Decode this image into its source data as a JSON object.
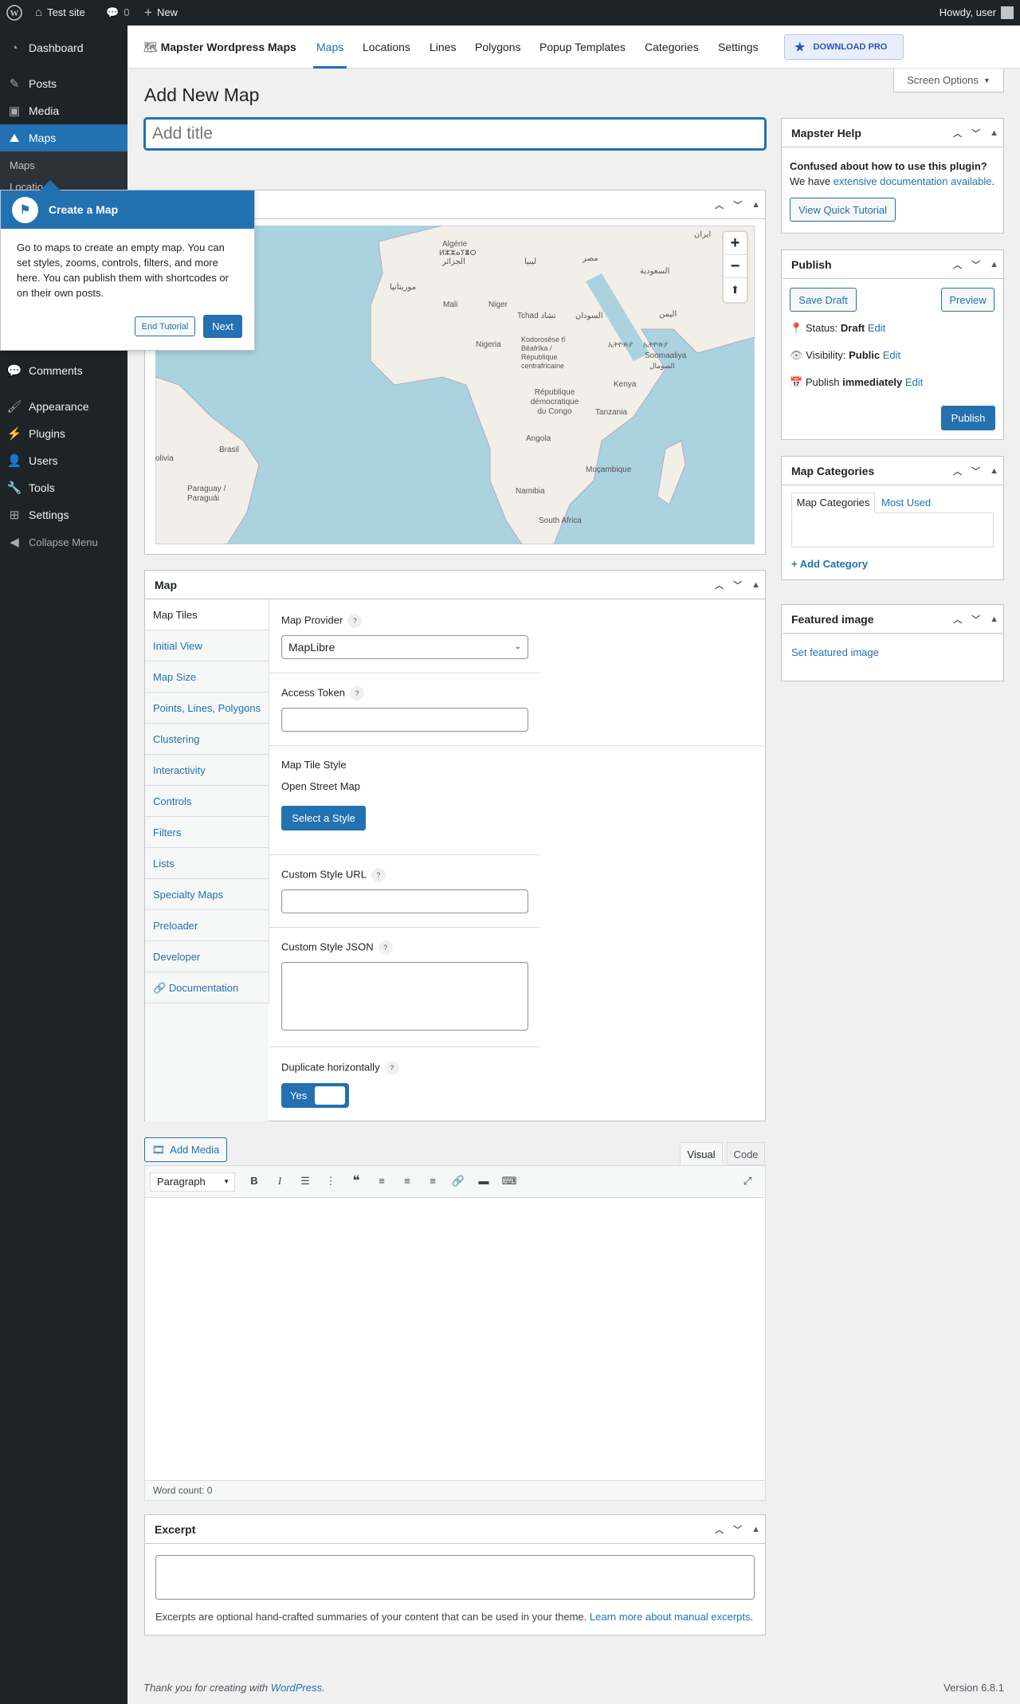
{
  "adminbar": {
    "site": "Test site",
    "comments": "0",
    "new": "New",
    "howdy": "Howdy, user"
  },
  "sidebar": {
    "items": [
      {
        "label": "Dashboard"
      },
      {
        "label": "Posts"
      },
      {
        "label": "Media"
      },
      {
        "label": "Maps"
      },
      {
        "label": "Comments"
      },
      {
        "label": "Appearance"
      },
      {
        "label": "Plugins"
      },
      {
        "label": "Users"
      },
      {
        "label": "Tools"
      },
      {
        "label": "Settings"
      },
      {
        "label": "Collapse Menu"
      }
    ],
    "submenu": [
      "Maps",
      "Locatio"
    ]
  },
  "tour": {
    "title": "Create a Map",
    "body": "Go to maps to create an empty map. You can set styles, zooms, controls, filters, and more here. You can publish them with shortcodes or on their own posts.",
    "end": "End Tutorial",
    "next": "Next"
  },
  "plugin_header": {
    "brand": "Mapster Wordpress Maps",
    "tabs": [
      "Maps",
      "Locations",
      "Lines",
      "Polygons",
      "Popup Templates",
      "Categories",
      "Settings"
    ],
    "download": "DOWNLOAD PRO"
  },
  "screen_options": "Screen Options",
  "page_title": "Add New Map",
  "title_placeholder": "Add title",
  "map_preview": {
    "labels": [
      "Algérie",
      "الجزائر",
      "ⵍⵣⵣⴰⵢⴻⵔ",
      "ليبيا",
      "مصر",
      "ایران",
      "السعودية",
      "موريتانيا",
      "Mali",
      "Niger",
      "Tchad تشاد",
      "السودان",
      "اليمن",
      "Nigeria",
      "Kodorosêse tî Bêafrîka / République centrafricaine",
      "ኢትዮጵያ",
      "ኢትዮጵያ",
      "Soomaaliya",
      "الصومال",
      "République démocratique du Congo",
      "Kenya",
      "Tanzania",
      "Brasil",
      "Angola",
      "Moçambique",
      "Namibia",
      "olivia",
      "Paraguay / Paraguái",
      "South Africa"
    ],
    "zoom_in": "+",
    "zoom_out": "−",
    "compass": "⬆"
  },
  "map_box": {
    "title": "Map",
    "tabs": [
      "Map Tiles",
      "Initial View",
      "Map Size",
      "Points, Lines, Polygons",
      "Clustering",
      "Interactivity",
      "Controls",
      "Filters",
      "Lists",
      "Specialty Maps",
      "Preloader",
      "Developer",
      "Documentation"
    ],
    "provider_label": "Map Provider",
    "provider_value": "MapLibre",
    "token_label": "Access Token",
    "tile_style_label": "Map Tile Style",
    "tile_style_value": "Open Street Map",
    "select_style": "Select a Style",
    "custom_url_label": "Custom Style URL",
    "custom_json_label": "Custom Style JSON",
    "dup_label": "Duplicate horizontally",
    "dup_value": "Yes",
    "help": "?"
  },
  "editor": {
    "add_media": "Add Media",
    "tab_visual": "Visual",
    "tab_code": "Code",
    "format": "Paragraph",
    "word_count": "Word count: 0"
  },
  "excerpt": {
    "title": "Excerpt",
    "help": "Excerpts are optional hand-crafted summaries of your content that can be used in your theme.",
    "link": "Learn more about manual excerpts"
  },
  "help_box": {
    "title": "Mapster Help",
    "question": "Confused about how to use this plugin?",
    "we_have": "We have",
    "link": "extensive documentation available",
    "button": "View Quick Tutorial"
  },
  "publish": {
    "title": "Publish",
    "save": "Save Draft",
    "preview": "Preview",
    "status_label": "Status:",
    "status": "Draft",
    "visibility_label": "Visibility:",
    "visibility": "Public",
    "publish_label": "Publish",
    "publish_when": "immediately",
    "edit": "Edit",
    "button": "Publish"
  },
  "categories": {
    "title": "Map Categories",
    "tab_all": "Map Categories",
    "tab_used": "Most Used",
    "add": "+ Add Category"
  },
  "featured": {
    "title": "Featured image",
    "link": "Set featured image"
  },
  "footer": {
    "thanks": "Thank you for creating with",
    "wp": "WordPress",
    "version": "Version 6.8.1"
  }
}
